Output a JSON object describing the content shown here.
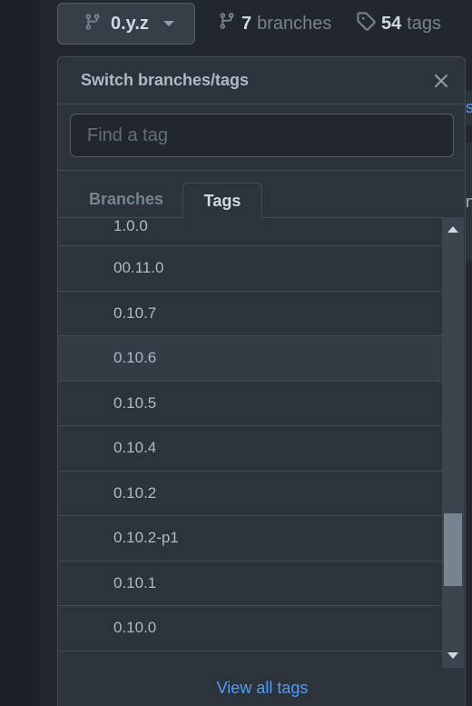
{
  "toolbar": {
    "branch_button_label": "0.y.z",
    "branches_count": "7",
    "branches_label": "branches",
    "tags_count": "54",
    "tags_label": "tags"
  },
  "edge_fragments": [
    "s",
    "n"
  ],
  "dropdown": {
    "title": "Switch branches/tags",
    "filter_placeholder": "Find a tag",
    "tabs": [
      {
        "label": "Branches",
        "selected": false
      },
      {
        "label": "Tags",
        "selected": true
      }
    ],
    "items": [
      "1.0.0",
      "00.11.0",
      "0.10.7",
      "0.10.6",
      "0.10.5",
      "0.10.4",
      "0.10.2",
      "0.10.2-p1",
      "0.10.1",
      "0.10.0"
    ],
    "footer_link": "View all tags"
  },
  "colors": {
    "background": "#22272e",
    "panel": "#2d333b",
    "border": "#444c56",
    "link": "#539bf5"
  }
}
